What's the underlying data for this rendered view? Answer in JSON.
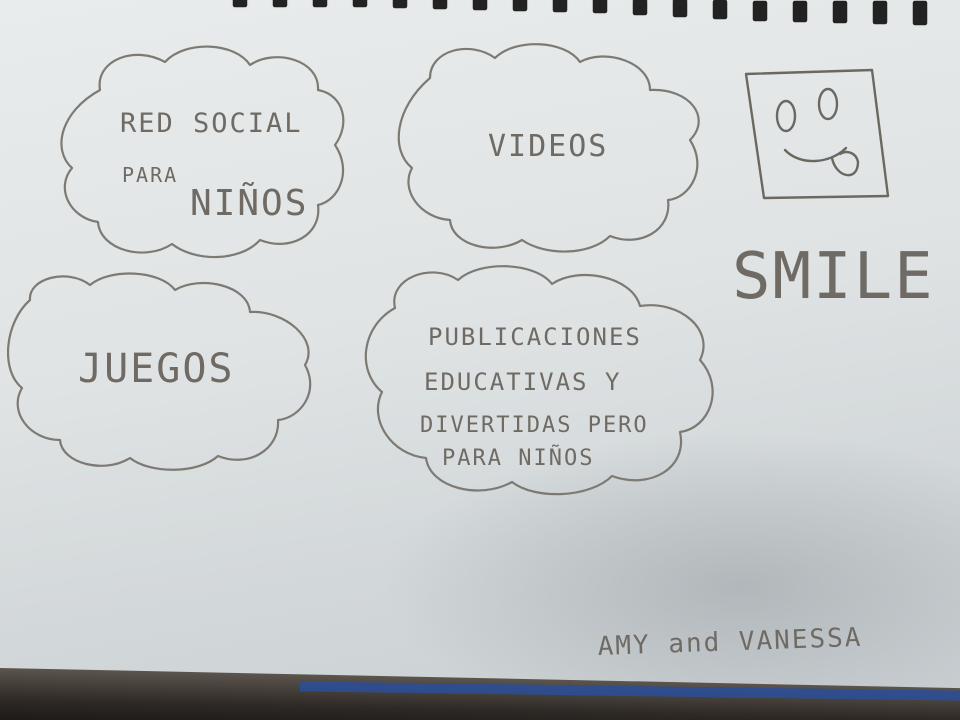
{
  "sketch": {
    "clouds": [
      {
        "lines": [
          "RED SOCIAL",
          "PARA",
          "NIÑOS"
        ]
      },
      {
        "lines": [
          "VIDEOS"
        ]
      },
      {
        "lines": [
          "JUEGOS"
        ]
      },
      {
        "lines": [
          "PUBLICACIONES",
          "EDUCATIVAS Y",
          "DIVERTIDAS PERO",
          "PARA NIÑOS"
        ]
      }
    ],
    "logo_word": "SMILE",
    "signature": "AMY and VANESSA",
    "colors": {
      "paper": "#e4e7e8",
      "pencil": "#7d7a74",
      "binding": "#222222",
      "table": "#2f2a26"
    },
    "icons": [
      "spiral-binding-icon",
      "smiley-face-icon"
    ]
  }
}
